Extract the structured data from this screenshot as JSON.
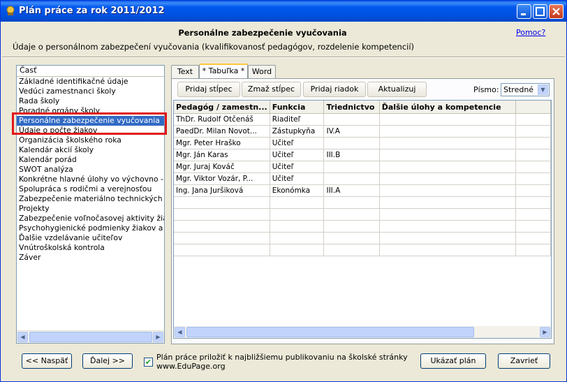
{
  "window": {
    "title": "Plán práce za rok 2011/2012"
  },
  "header": {
    "title": "Personálne zabezpečenie vyučovania",
    "subtitle": "Údaje o personálnom zabezpečení vyučovania (kvalifikovanosť pedagógov, rozdelenie kompetencií)",
    "help_link": "Pomoc?"
  },
  "sidebar": {
    "header": "Časť",
    "items": [
      {
        "label": "Základné identifikačné údaje"
      },
      {
        "label": "Vedúci zamestnanci školy"
      },
      {
        "label": "Rada školy"
      },
      {
        "label": "Poradné orgány školy"
      },
      {
        "label": "Personálne zabezpečenie vyučovania"
      },
      {
        "label": "Údaje o počte žiakov"
      },
      {
        "label": "Organizácia školského roka"
      },
      {
        "label": "Kalendár akcií školy"
      },
      {
        "label": "Kalendár porád"
      },
      {
        "label": "SWOT analýza"
      },
      {
        "label": "Konkrétne hlavné úlohy vo výchovno - vzde"
      },
      {
        "label": "Spolupráca s rodičmi a verejnosťou"
      },
      {
        "label": "Zabezpečenie materiálno technických podm"
      },
      {
        "label": "Projekty"
      },
      {
        "label": "Zabezpečenie voľnočasovej aktivity žiakov"
      },
      {
        "label": "Psychohygienické podmienky žiakov a učite"
      },
      {
        "label": "Ďalšie vzdelávanie učiteľov"
      },
      {
        "label": "Vnútroškolská kontrola"
      },
      {
        "label": "Záver"
      }
    ]
  },
  "tabs": [
    {
      "label": "Text"
    },
    {
      "label": "* Tabuľka *"
    },
    {
      "label": "Word"
    }
  ],
  "toolbar": {
    "add_column": "Pridaj stĺpec",
    "delete_column": "Zmaž stĺpec",
    "add_row": "Pridaj riadok",
    "refresh": "Aktualizuj",
    "font_label": "Písmo:",
    "font_value": "Stredné"
  },
  "table": {
    "columns": [
      "Pedagóg / zamestn...",
      "Funkcia",
      "Triednictvo",
      "Ďalšie úlohy a kompetencie"
    ],
    "rows": [
      [
        "ThDr. Rudolf Otčenáš",
        "Riaditeľ",
        "",
        ""
      ],
      [
        "PaedDr. Milan Novot...",
        "Zástupkyňa",
        "IV.A",
        ""
      ],
      [
        "Mgr. Peter Hraško",
        "Učiteľ",
        "",
        ""
      ],
      [
        "Mgr. Ján Karas",
        "Učiteľ",
        "III.B",
        ""
      ],
      [
        "Mgr. Juraj Kováč",
        "Učiteľ",
        "",
        ""
      ],
      [
        "Mgr. Viktor Vozár, P...",
        "Učiteľ",
        "",
        ""
      ],
      [
        "Ing. Jana Juršiková",
        "Ekonómka",
        "III.A",
        ""
      ],
      [
        "",
        "",
        "",
        ""
      ],
      [
        "",
        "",
        "",
        ""
      ],
      [
        "",
        "",
        "",
        ""
      ],
      [
        "",
        "",
        "",
        ""
      ],
      [
        "",
        "",
        "",
        ""
      ]
    ]
  },
  "footer": {
    "back": "<< Naspäť",
    "next": "Ďalej >>",
    "publish_checked": true,
    "publish_line1": "Plán práce priložiť k najbližšiemu publikovaniu na školské stránky",
    "publish_line2": "www.EduPage.org",
    "show_plan": "Ukázať plán",
    "close": "Zavrieť"
  },
  "colors": {
    "selection": "#316ac5",
    "highlight": "#e0161a",
    "titlebar": "#0058ee"
  }
}
